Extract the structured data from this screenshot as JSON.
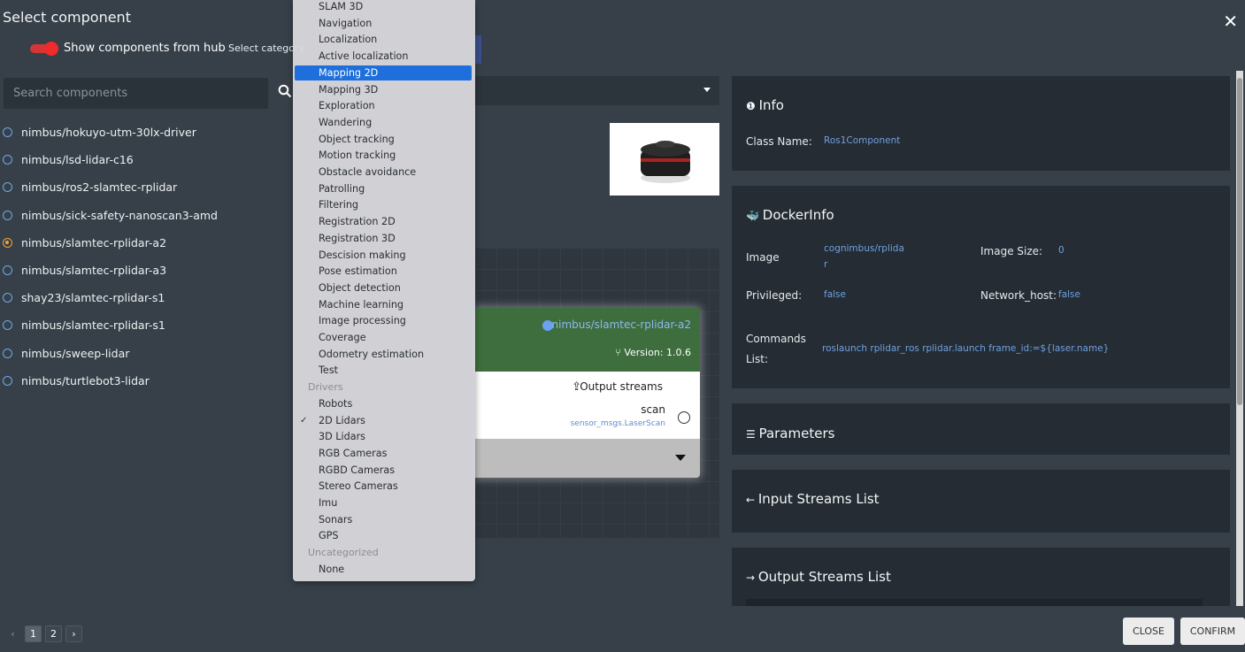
{
  "dialog": {
    "title": "Select component",
    "close_icon": "close-icon"
  },
  "hub_toggle": {
    "label": "Show components from hub",
    "on": true
  },
  "category": {
    "label": "Select category"
  },
  "search": {
    "placeholder": "Search components"
  },
  "components": [
    {
      "name": "nimbus/hokuyo-utm-30lx-driver",
      "selected": false
    },
    {
      "name": "nimbus/lsd-lidar-c16",
      "selected": false
    },
    {
      "name": "nimbus/ros2-slamtec-rplidar",
      "selected": false
    },
    {
      "name": "nimbus/sick-safety-nanoscan3-amd",
      "selected": false
    },
    {
      "name": "nimbus/slamtec-rplidar-a2",
      "selected": true
    },
    {
      "name": "nimbus/slamtec-rplidar-a3",
      "selected": false
    },
    {
      "name": "shay23/slamtec-rplidar-s1",
      "selected": false
    },
    {
      "name": "nimbus/slamtec-rplidar-s1",
      "selected": false
    },
    {
      "name": "nimbus/sweep-lidar",
      "selected": false
    },
    {
      "name": "nimbus/turtlebot3-lidar",
      "selected": false
    }
  ],
  "dropdown": {
    "items": [
      "SLAM 3D",
      "Navigation",
      "Localization",
      "Active localization",
      "Mapping 2D",
      "Mapping 3D",
      "Exploration",
      "Wandering",
      "Object tracking",
      "Motion tracking",
      "Obstacle avoidance",
      "Patrolling",
      "Filtering",
      "Registration 2D",
      "Registration 3D",
      "Descision making",
      "Pose estimation",
      "Object detection",
      "Machine learning",
      "Image processing",
      "Coverage",
      "Odometry estimation",
      "Test"
    ],
    "highlighted": "Mapping 2D",
    "groups": [
      {
        "label": "Drivers",
        "items": [
          "Robots",
          "2D Lidars",
          "3D Lidars",
          "RGB Cameras",
          "RGBD Cameras",
          "Stereo Cameras",
          "Imu",
          "Sonars",
          "GPS"
        ]
      },
      {
        "label": "Uncategorized",
        "items": [
          "None"
        ]
      }
    ],
    "checked": "2D Lidars"
  },
  "node": {
    "name": "nimbus/slamtec-rplidar-a2",
    "version": "Version: 1.0.6",
    "output_title": "Output streams",
    "stream_name": "scan",
    "stream_type": "sensor_msgs.LaserScan"
  },
  "info": {
    "title": "Info",
    "class_name_label": "Class Name:",
    "class_name": "Ros1Component"
  },
  "docker": {
    "title": "DockerInfo",
    "image_label": "Image",
    "image_line1": "cognimbus/rplida",
    "image_line2": "r",
    "image_size_label": "Image Size:",
    "image_size": "0",
    "privileged_label": "Privileged:",
    "privileged": "false",
    "network_label": "Network_host:",
    "network": "false",
    "commands_label1": "Commands",
    "commands_label2": "List:",
    "commands": "roslaunch rplidar_ros rplidar.launch frame_id:=${laser.name}"
  },
  "sections": {
    "parameters": "Parameters",
    "input_streams": "Input Streams List",
    "output_streams": "Output Streams List"
  },
  "pager": {
    "prev": "‹",
    "pages": [
      "1",
      "2"
    ],
    "current": "1",
    "next": "›"
  },
  "buttons": {
    "close": "CLOSE",
    "confirm": "CONFIRM"
  },
  "colors": {
    "accent": "#1e6fdc",
    "toggle": "#ef2b2b",
    "node_header": "#3f6e3e",
    "link": "#6fa0e0"
  }
}
